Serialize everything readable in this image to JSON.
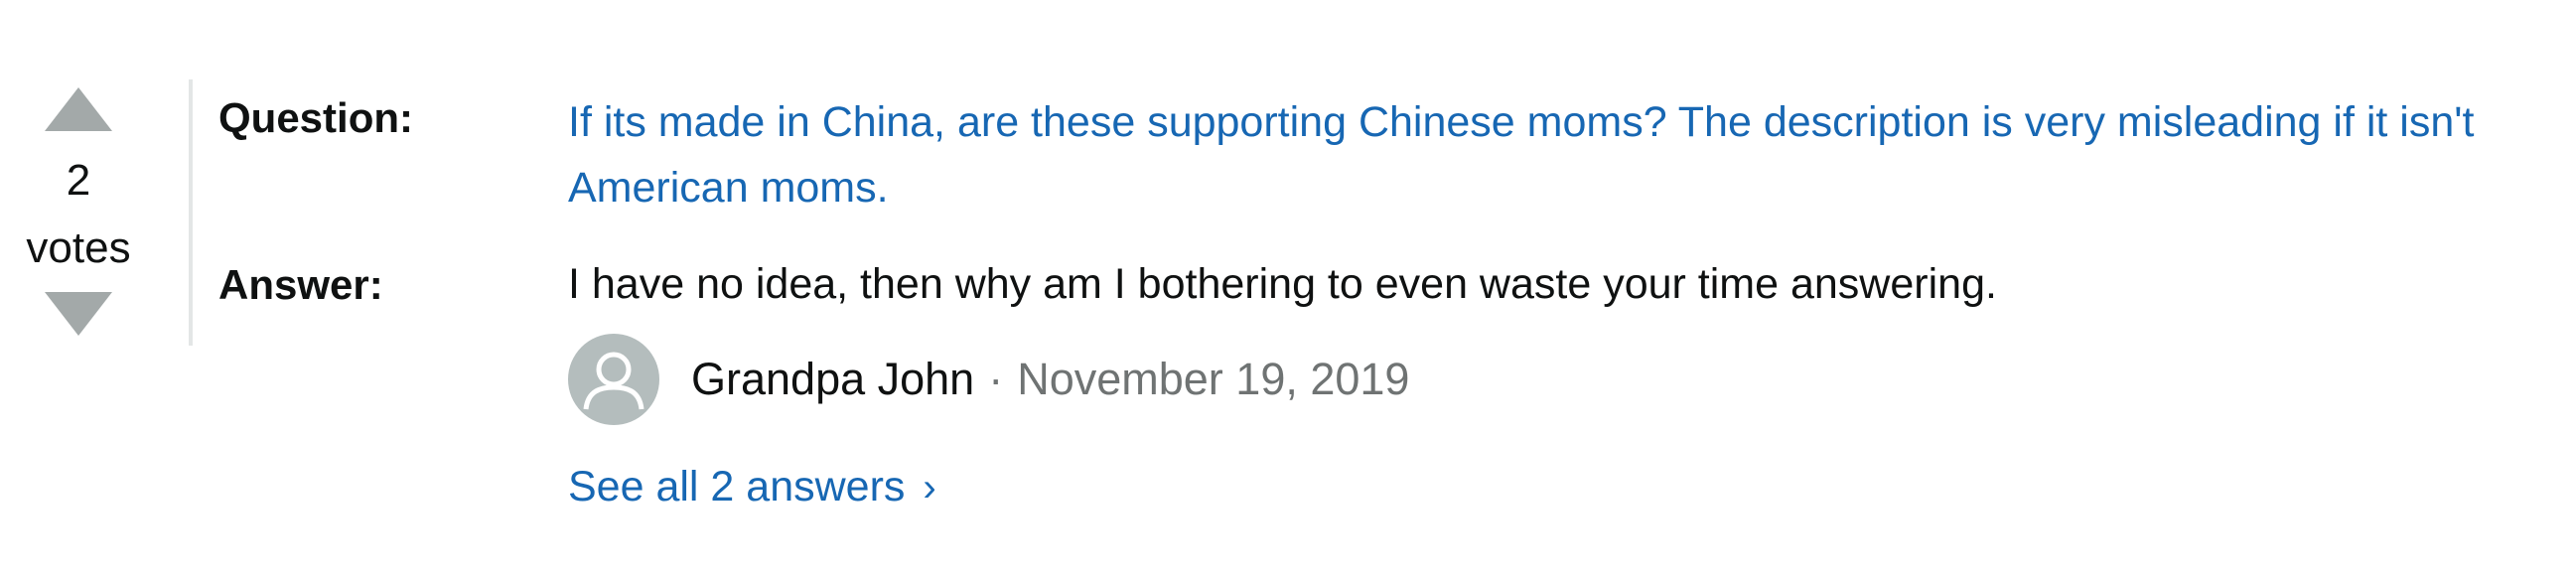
{
  "votes": {
    "count": "2",
    "label": "votes"
  },
  "question": {
    "label": "Question:",
    "text": "If its made in China, are these supporting Chinese moms? The description is very misleading if it isn't American moms."
  },
  "answer": {
    "label": "Answer:",
    "text": "I have no idea, then why am I bothering to even waste your time answering.",
    "author": "Grandpa John",
    "separator": "·",
    "date": "November 19, 2019"
  },
  "see_all": {
    "label": "See all 2 answers",
    "chevron": "›"
  },
  "icons": {
    "vote_up": "triangle-up-icon",
    "vote_down": "triangle-down-icon",
    "avatar": "user-silhouette-icon"
  },
  "colors": {
    "link": "#1767b3",
    "text": "#0f1111",
    "muted": "#6f7373",
    "vote_arrow": "#a3a9a9",
    "avatar_bg": "#b4bdbd"
  }
}
